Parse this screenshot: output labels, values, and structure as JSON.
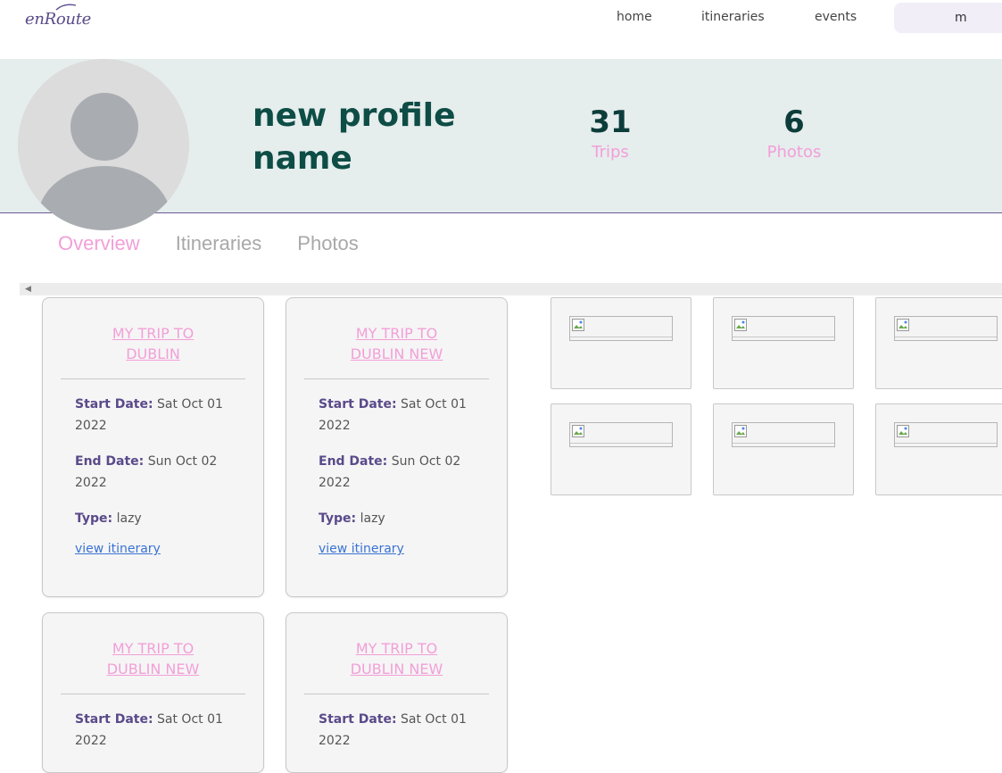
{
  "brand": {
    "logo": "enRoute"
  },
  "nav": {
    "home": "home",
    "itineraries": "itineraries",
    "events": "events",
    "user": "m"
  },
  "profile": {
    "name": "new profile name",
    "stats": {
      "trips": {
        "value": "31",
        "label": "Trips"
      },
      "photos": {
        "value": "6",
        "label": "Photos"
      }
    }
  },
  "tabs": [
    {
      "label": "Overview",
      "active": true
    },
    {
      "label": "Itineraries",
      "active": false
    },
    {
      "label": "Photos",
      "active": false
    }
  ],
  "field_labels": {
    "start": "Start Date:",
    "end": "End Date:",
    "type": "Type:",
    "link": "view itinerary"
  },
  "trips": [
    {
      "title": "MY TRIP TO DUBLIN",
      "start": "Sat Oct 01 2022",
      "end": "Sun Oct 02 2022",
      "type": "lazy"
    },
    {
      "title": "MY TRIP TO DUBLIN NEW",
      "start": "Sat Oct 01 2022",
      "end": "Sun Oct 02 2022",
      "type": "lazy"
    },
    {
      "title": "MY TRIP TO DUBLIN NEW",
      "start": "Sat Oct 01 2022"
    },
    {
      "title": "MY TRIP TO DUBLIN NEW",
      "start": "Sat Oct 01 2022"
    }
  ],
  "photos_count_shown": 6,
  "colors": {
    "accent_pink": "#f29fd8",
    "name_teal": "#0d4d45",
    "banner_bg": "#e6eded",
    "label_purple": "#5a4a8a",
    "link_blue": "#3a73d4"
  }
}
